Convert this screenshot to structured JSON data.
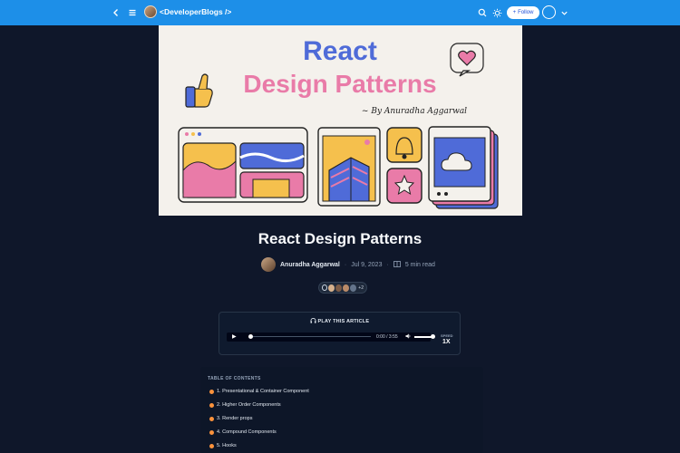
{
  "topbar": {
    "brand_name": "<DeveloperBlogs />",
    "follow_label": "Follow"
  },
  "cover": {
    "line1": "React",
    "line2": "Design Patterns",
    "byline": "~ By Anuradha Aggarwal"
  },
  "article": {
    "title": "React Design Patterns",
    "author": "Anuradha Aggarwal",
    "date": "Jul 9, 2023",
    "read_time": "5 min read",
    "reaction_count": "+2"
  },
  "player": {
    "label": "PLAY THIS ARTICLE",
    "time": "0:00 / 3:55",
    "speed_label": "SPEED",
    "speed_value": "1X",
    "progress_fraction": 0,
    "volume_fraction": 1
  },
  "toc": {
    "heading": "TABLE OF CONTENTS",
    "items": [
      "1. Presentational & Container Component",
      "2. Higher Order Components",
      "3. Render props",
      "4. Compound Components",
      "5. Hooks"
    ]
  },
  "colors": {
    "topbar": "#1d8fe8",
    "background": "#0f172a",
    "cover_blue": "#4f6bd8",
    "cover_pink": "#e97ba8",
    "cover_yellow": "#f5c04d",
    "bullet": "#fb923c"
  }
}
